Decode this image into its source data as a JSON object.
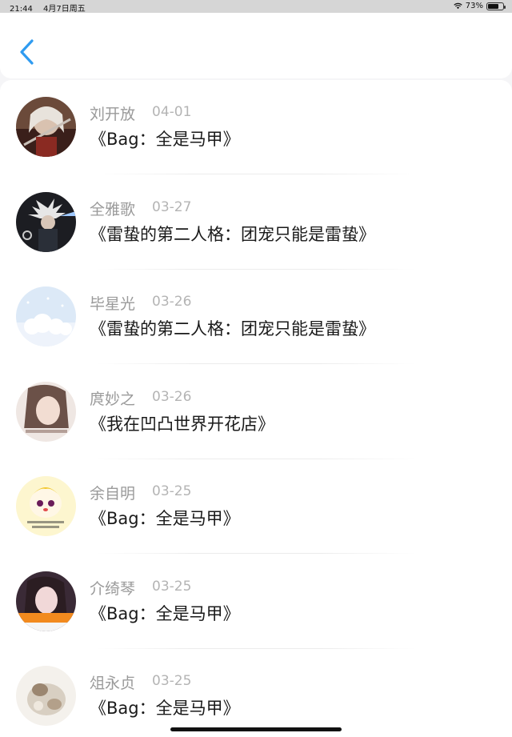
{
  "status_bar": {
    "time": "21:44",
    "date": "4月7日周五",
    "battery": "73%",
    "battery_level": 0.73
  },
  "header": {
    "back_icon": "chevron-left-icon",
    "accent_color": "#2f9bf0"
  },
  "items": [
    {
      "name": "刘开放",
      "date": "04-01",
      "title": "《Bag：全是马甲》",
      "avatar": "illustrated-warrior-avatar"
    },
    {
      "name": "全雅歌",
      "date": "03-27",
      "title": "《雷蛰的第二人格：团宠只能是雷蛰》",
      "avatar": "anime-ninja-avatar"
    },
    {
      "name": "毕星光",
      "date": "03-26",
      "title": "《雷蛰的第二人格：团宠只能是雷蛰》",
      "avatar": "cloud-sky-avatar"
    },
    {
      "name": "庹妙之",
      "date": "03-26",
      "title": "《我在凹凸世界开花店》",
      "avatar": "girl-portrait-avatar"
    },
    {
      "name": "余自明",
      "date": "03-25",
      "title": "《Bag：全是马甲》",
      "avatar": "cartoon-egg-avatar"
    },
    {
      "name": "介绮琴",
      "date": "03-25",
      "title": "《Bag：全是马甲》",
      "avatar": "girl-photo-avatar"
    },
    {
      "name": "俎永贞",
      "date": "03-25",
      "title": "《Bag：全是马甲》",
      "avatar": "cat-photo-avatar"
    }
  ]
}
